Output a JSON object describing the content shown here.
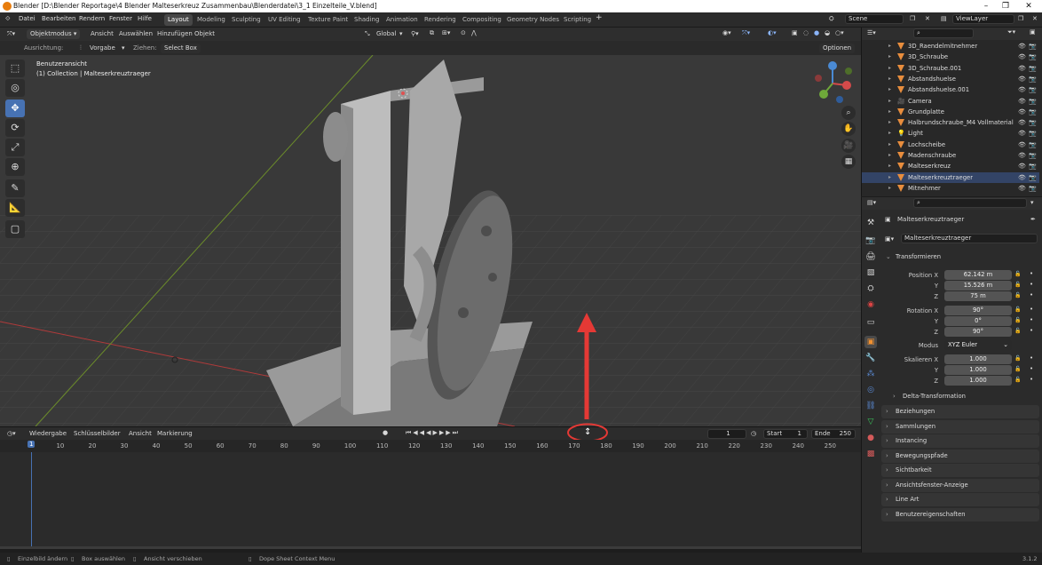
{
  "title": "Blender [D:\\Blender Reportage\\4 Blender Malteserkreuz Zusammenbau\\Blenderdatei\\3_1 Einzelteile_V.blend]",
  "menus": [
    "Datei",
    "Bearbeiten",
    "Rendern",
    "Fenster",
    "Hilfe"
  ],
  "workspaces": [
    "Layout",
    "Modeling",
    "Sculpting",
    "UV Editing",
    "Texture Paint",
    "Shading",
    "Animation",
    "Rendering",
    "Compositing",
    "Geometry Nodes",
    "Scripting"
  ],
  "scene": "Scene",
  "view_layer": "ViewLayer",
  "vp_header": {
    "mode": "Objektmodus",
    "items": [
      "Ansicht",
      "Auswählen",
      "Hinzufügen",
      "Objekt"
    ],
    "orientation": "Global",
    "options": "Optionen"
  },
  "tool_header": {
    "ausrichtung": "Ausrichtung:",
    "vorgabe": "Vorgabe",
    "ziehen": "Ziehen:",
    "select_box": "Select Box"
  },
  "viewport": {
    "view_name": "Benutzeransicht",
    "collection": "(1) Collection | Malteserkreuztraeger"
  },
  "timeline": {
    "items": [
      "Wiedergabe",
      "Schlüsselbilder",
      "Ansicht",
      "Markierung"
    ],
    "current": "1",
    "start_label": "Start",
    "start": "1",
    "end_label": "Ende",
    "end": "250",
    "ticks": [
      "1",
      "10",
      "20",
      "30",
      "40",
      "50",
      "60",
      "70",
      "80",
      "90",
      "100",
      "110",
      "120",
      "130",
      "140",
      "150",
      "160",
      "170",
      "180",
      "190",
      "200",
      "210",
      "220",
      "230",
      "240",
      "250"
    ]
  },
  "outliner": [
    "3D_Raendelmitnehmer",
    "3D_Schraube",
    "3D_Schraube.001",
    "Abstandshuelse",
    "Abstandshuelse.001",
    "Camera",
    "Grundplatte",
    "Halbrundschraube_M4 Vollmaterial",
    "Light",
    "Lochscheibe",
    "Madenschraube",
    "Malteserkreuz",
    "Malteserkreuztraeger",
    "Mitnehmer"
  ],
  "props": {
    "object": "Malteserkreuztraeger",
    "object2": "Malteserkreuztraeger",
    "transform": "Transformieren",
    "pos_label": "Position X",
    "pos": [
      "62.142 m",
      "15.526 m",
      "75 m"
    ],
    "rot_label": "Rotation X",
    "rot": [
      "90°",
      "0°",
      "90°"
    ],
    "mode_label": "Modus",
    "mode": "XYZ Euler",
    "scale_label": "Skalieren X",
    "scale": [
      "1.000",
      "1.000",
      "1.000"
    ],
    "y": "Y",
    "z": "Z",
    "delta": "Delta-Transformation",
    "panels": [
      "Beziehungen",
      "Sammlungen",
      "Instancing",
      "Bewegungspfade",
      "Sichtbarkeit",
      "Ansichtsfenster-Anzeige",
      "Line Art",
      "Benutzereigenschaften"
    ]
  },
  "status": {
    "a": "Einzelbild ändern",
    "b": "Box auswählen",
    "c": "Ansicht verschieben",
    "d": "Dope Sheet Context Menu",
    "version": "3.1.2"
  },
  "accent": "#4772b3",
  "annotation_color": "#e53935"
}
